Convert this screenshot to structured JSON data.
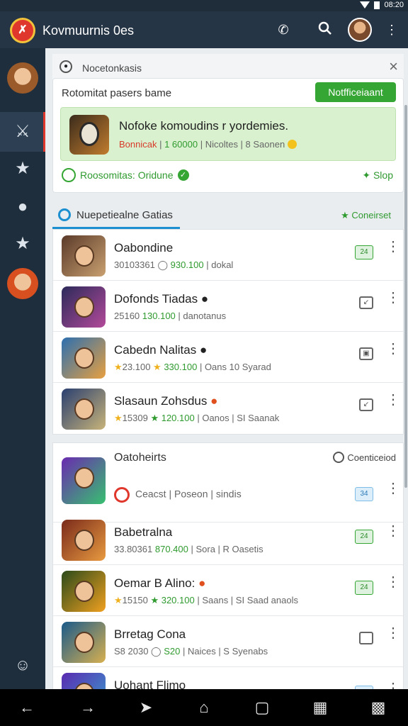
{
  "status": {
    "time": "08:20"
  },
  "appbar": {
    "title": "Kovmuurnis 0es",
    "logo_icon": "app-logo-icon",
    "phone_icon": "phone-icon",
    "search_icon": "search-icon",
    "avatar": "avatar",
    "menu_icon": "more-vertical-icon"
  },
  "notice": {
    "title": "Nocetonkasis",
    "subtitle": "Rotomitat pasers bame",
    "button": "Notfficeiaant",
    "promo_title": "Nofoke komoudins r yordemies.",
    "promo_red": "Bonnicak",
    "promo_green": "1 60000",
    "promo_rest": "Nicoltes | 8 Saonen",
    "foot_left": "Roosomitas: Oridune",
    "foot_right": "Slop"
  },
  "section1": {
    "label": "Nuepetiealne Gatias",
    "right": "Coneirset",
    "items": [
      {
        "name": "Oabondine",
        "meta_left": "30103361",
        "meta_green": "930.100",
        "meta_right": "| dokal",
        "badge": "24"
      },
      {
        "name": "Dofonds Tiadas",
        "meta_left": "25160",
        "meta_green": "130.100",
        "meta_right": "| danotanus",
        "badge": ""
      },
      {
        "name": "Cabedn Nalitas",
        "meta_left": "23.100",
        "meta_green": "330.100",
        "meta_right": "| Oans 10 Syarad",
        "badge": ""
      },
      {
        "name": "Slasaun Zohsdus",
        "meta_left": "15309",
        "meta_green": "120.100",
        "meta_right": "| Oanos | SI Saanak",
        "badge": ""
      }
    ]
  },
  "section2": {
    "label": "Oatoheirts",
    "right": "Coenticeiod",
    "items": [
      {
        "name": "",
        "meta_left": "Ceacst",
        "meta_green": "Poseon",
        "meta_right": "| sindis",
        "badge": "34"
      },
      {
        "name": "Babetralna",
        "meta_left": "33.80361",
        "meta_green": "870.400",
        "meta_right": "| Sora | R Oasetis",
        "badge": "24"
      },
      {
        "name": "Oemar B Alino:",
        "meta_left": "15150",
        "meta_green": "320.100",
        "meta_right": "| Saans | SI Saad anaols",
        "badge": "24"
      },
      {
        "name": "Brretag Cona",
        "meta_left": "S8 2030",
        "meta_green": "S20",
        "meta_right": "| Naices | S Syenabs",
        "badge": ""
      },
      {
        "name": "Uohant Flimo",
        "meta_left": "",
        "meta_green": "",
        "meta_right": "",
        "badge": ""
      }
    ]
  },
  "nav": [
    "back-icon",
    "forward-icon",
    "share-icon",
    "home-icon",
    "tabs-icon",
    "gallery-icon",
    "settings-icon"
  ]
}
